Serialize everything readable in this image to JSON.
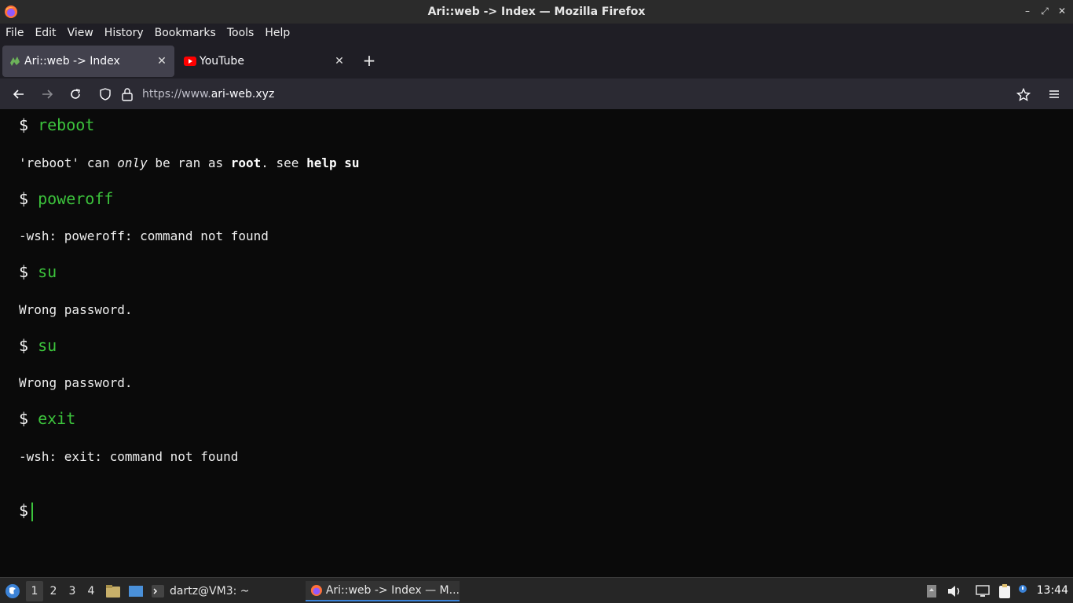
{
  "window": {
    "title": "Ari::web -> Index — Mozilla Firefox",
    "controls": [
      "–",
      "⤢",
      "✕"
    ]
  },
  "menubar": {
    "items": [
      "File",
      "Edit",
      "View",
      "History",
      "Bookmarks",
      "Tools",
      "Help"
    ]
  },
  "tabs": [
    {
      "label": "Ari::web -> Index",
      "active": true,
      "favicon": "ari-web-icon"
    },
    {
      "label": "YouTube",
      "active": false,
      "favicon": "youtube-icon"
    }
  ],
  "newtab": "+",
  "urlbar": {
    "prefix": "https://www.",
    "host": "ari-web.xyz"
  },
  "terminal": {
    "prompt_symbol": "$",
    "lines": [
      {
        "type": "prompt",
        "cmd": "reboot"
      },
      {
        "type": "output",
        "parts": [
          "'reboot' can ",
          "only",
          " be ran as ",
          "root",
          ". see ",
          "help su"
        ]
      },
      {
        "type": "prompt",
        "cmd": "poweroff"
      },
      {
        "type": "output",
        "text": "-wsh: poweroff: command not found"
      },
      {
        "type": "prompt",
        "cmd": "su"
      },
      {
        "type": "output",
        "text": "Wrong password."
      },
      {
        "type": "prompt",
        "cmd": "su"
      },
      {
        "type": "output",
        "text": "Wrong password."
      },
      {
        "type": "prompt",
        "cmd": "exit"
      },
      {
        "type": "output",
        "text": "-wsh: exit: command not found"
      },
      {
        "type": "prompt",
        "cmd": ""
      }
    ]
  },
  "taskbar": {
    "workspaces": [
      "1",
      "2",
      "3",
      "4"
    ],
    "active_workspace": "1",
    "tasks": [
      {
        "label": "dartz@VM3: ~"
      },
      {
        "label": "Ari::web -> Index — M..."
      }
    ],
    "clock": "13:44"
  }
}
